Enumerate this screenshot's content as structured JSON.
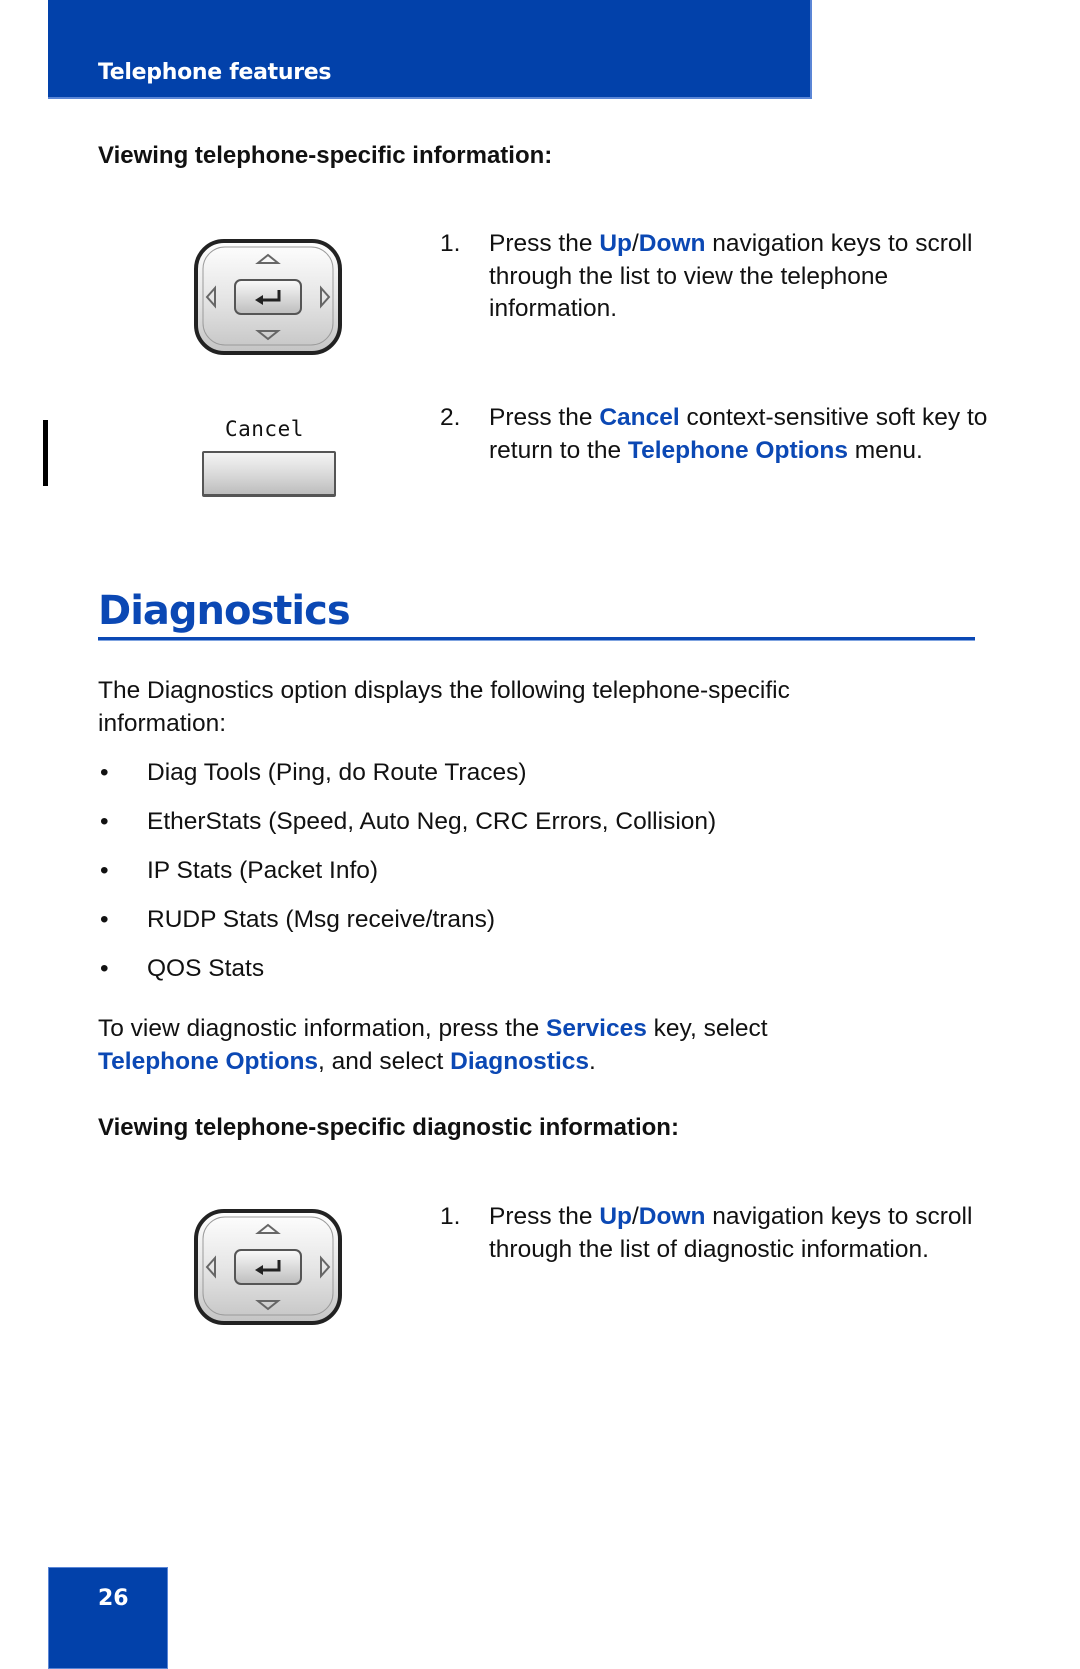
{
  "header": {
    "title": "Telephone features"
  },
  "section1": {
    "subheading": "Viewing telephone-specific information:",
    "steps": [
      {
        "num": "1.",
        "key_icon": "navigation-cluster-icon",
        "parts": [
          "Press the ",
          "Up",
          "/",
          "Down",
          " navigation keys to scroll through the list to view the telephone information."
        ]
      },
      {
        "num": "2.",
        "key_icon": "softkey-icon",
        "softkey_label": "Cancel",
        "parts": [
          "Press the ",
          "Cancel",
          " context-sensitive soft key to return to the ",
          "Telephone Options",
          " menu."
        ]
      }
    ]
  },
  "diagnostics": {
    "heading": "Diagnostics",
    "intro": "The Diagnostics option displays the following telephone-specific information:",
    "bullet_char": "•",
    "bullets": [
      "Diag Tools (Ping, do Route Traces)",
      "EtherStats (Speed, Auto Neg, CRC Errors, Collision)",
      "IP Stats (Packet Info)",
      "RUDP Stats (Msg receive/trans)",
      "QOS Stats"
    ],
    "instruction_parts": [
      "To view diagnostic information, press the ",
      "Services",
      " key, select ",
      "Telephone Options",
      ", and select ",
      "Diagnostics",
      "."
    ]
  },
  "section2": {
    "subheading": "Viewing telephone-specific diagnostic information:",
    "steps": [
      {
        "num": "1.",
        "key_icon": "navigation-cluster-icon",
        "parts": [
          "Press the ",
          "Up",
          "/",
          "Down",
          " navigation keys to scroll through the list of diagnostic information."
        ]
      }
    ]
  },
  "footer": {
    "page_number": "26"
  },
  "colors": {
    "brand_blue": "#0241AA",
    "highlight_blue": "#0B48B4"
  }
}
